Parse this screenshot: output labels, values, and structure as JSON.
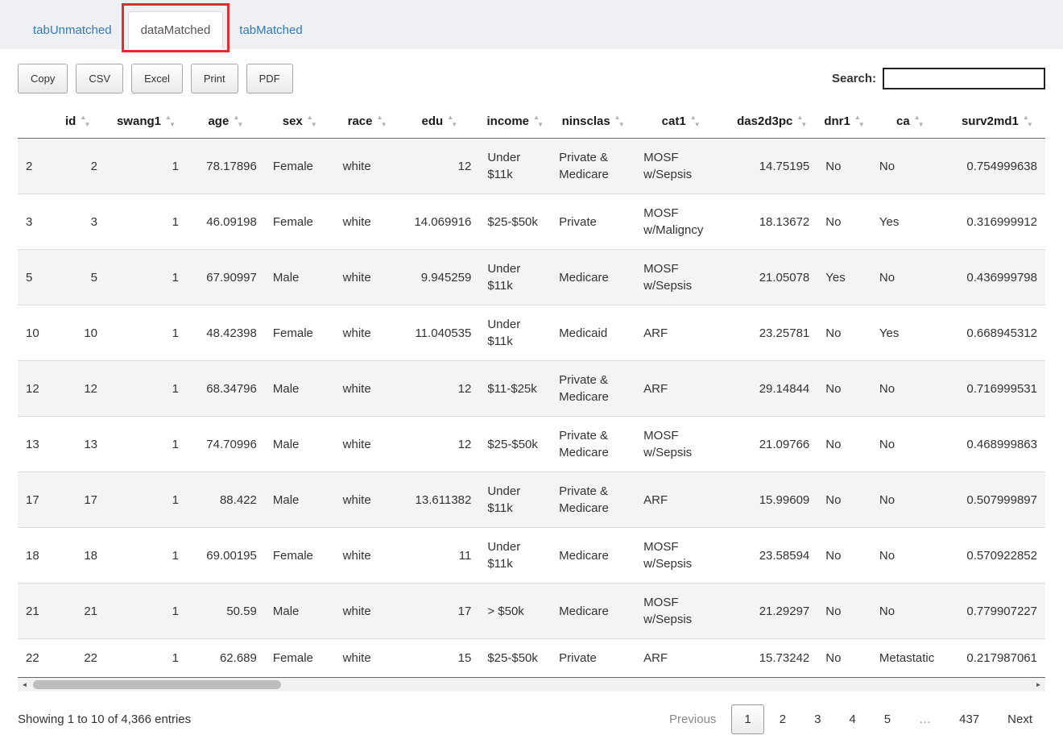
{
  "theme": {
    "link_color": "#337ab7",
    "annotation_color": "#e12d2d"
  },
  "tabs": [
    {
      "label": "tabUnmatched",
      "active": false,
      "highlighted": false
    },
    {
      "label": "dataMatched",
      "active": true,
      "highlighted": true
    },
    {
      "label": "tabMatched",
      "active": false,
      "highlighted": false
    }
  ],
  "toolbar": {
    "buttons": [
      "Copy",
      "CSV",
      "Excel",
      "Print",
      "PDF"
    ],
    "search_label": "Search:",
    "search_value": ""
  },
  "table": {
    "columns": [
      {
        "label": "",
        "align": "left",
        "sortable": false
      },
      {
        "label": "id",
        "align": "right",
        "sortable": true
      },
      {
        "label": "swang1",
        "align": "right",
        "sortable": true
      },
      {
        "label": "age",
        "align": "right",
        "sortable": true
      },
      {
        "label": "sex",
        "align": "left",
        "sortable": true
      },
      {
        "label": "race",
        "align": "left",
        "sortable": true
      },
      {
        "label": "edu",
        "align": "right",
        "sortable": true
      },
      {
        "label": "income",
        "align": "left",
        "sortable": true
      },
      {
        "label": "ninsclas",
        "align": "left",
        "sortable": true
      },
      {
        "label": "cat1",
        "align": "left",
        "sortable": true
      },
      {
        "label": "das2d3pc",
        "align": "right",
        "sortable": true
      },
      {
        "label": "dnr1",
        "align": "left",
        "sortable": true
      },
      {
        "label": "ca",
        "align": "left",
        "sortable": true
      },
      {
        "label": "surv2md1",
        "align": "right",
        "sortable": true
      }
    ],
    "rows": [
      [
        "2",
        "2",
        "1",
        "78.17896",
        "Female",
        "white",
        "12",
        "Under $11k",
        "Private & Medicare",
        "MOSF w/Sepsis",
        "14.75195",
        "No",
        "No",
        "0.754999638"
      ],
      [
        "3",
        "3",
        "1",
        "46.09198",
        "Female",
        "white",
        "14.069916",
        "$25-$50k",
        "Private",
        "MOSF w/Maligncy",
        "18.13672",
        "No",
        "Yes",
        "0.316999912"
      ],
      [
        "5",
        "5",
        "1",
        "67.90997",
        "Male",
        "white",
        "9.945259",
        "Under $11k",
        "Medicare",
        "MOSF w/Sepsis",
        "21.05078",
        "Yes",
        "No",
        "0.436999798"
      ],
      [
        "10",
        "10",
        "1",
        "48.42398",
        "Female",
        "white",
        "11.040535",
        "Under $11k",
        "Medicaid",
        "ARF",
        "23.25781",
        "No",
        "Yes",
        "0.668945312"
      ],
      [
        "12",
        "12",
        "1",
        "68.34796",
        "Male",
        "white",
        "12",
        "$11-$25k",
        "Private & Medicare",
        "ARF",
        "29.14844",
        "No",
        "No",
        "0.716999531"
      ],
      [
        "13",
        "13",
        "1",
        "74.70996",
        "Male",
        "white",
        "12",
        "$25-$50k",
        "Private & Medicare",
        "MOSF w/Sepsis",
        "21.09766",
        "No",
        "No",
        "0.468999863"
      ],
      [
        "17",
        "17",
        "1",
        "88.422",
        "Male",
        "white",
        "13.611382",
        "Under $11k",
        "Private & Medicare",
        "ARF",
        "15.99609",
        "No",
        "No",
        "0.507999897"
      ],
      [
        "18",
        "18",
        "1",
        "69.00195",
        "Female",
        "white",
        "11",
        "Under $11k",
        "Medicare",
        "MOSF w/Sepsis",
        "23.58594",
        "No",
        "No",
        "0.570922852"
      ],
      [
        "21",
        "21",
        "1",
        "50.59",
        "Male",
        "white",
        "17",
        "> $50k",
        "Medicare",
        "MOSF w/Sepsis",
        "21.29297",
        "No",
        "No",
        "0.779907227"
      ],
      [
        "22",
        "22",
        "1",
        "62.689",
        "Female",
        "white",
        "15",
        "$25-$50k",
        "Private",
        "ARF",
        "15.73242",
        "No",
        "Metastatic",
        "0.217987061"
      ]
    ]
  },
  "footer": {
    "info": "Showing 1 to 10 of 4,366 entries",
    "pagination": [
      {
        "label": "Previous",
        "name": "previous-button",
        "state": "disabled",
        "interactable": true
      },
      {
        "label": "1",
        "name": "page-1-button",
        "state": "current",
        "interactable": true
      },
      {
        "label": "2",
        "name": "page-2-button",
        "state": "normal",
        "interactable": true
      },
      {
        "label": "3",
        "name": "page-3-button",
        "state": "normal",
        "interactable": true
      },
      {
        "label": "4",
        "name": "page-4-button",
        "state": "normal",
        "interactable": true
      },
      {
        "label": "5",
        "name": "page-5-button",
        "state": "normal",
        "interactable": true
      },
      {
        "label": "…",
        "name": "pagination-ellipsis",
        "state": "disabled",
        "interactable": false
      },
      {
        "label": "437",
        "name": "page-437-button",
        "state": "normal",
        "interactable": true
      },
      {
        "label": "Next",
        "name": "next-button",
        "state": "normal",
        "interactable": true
      }
    ]
  }
}
